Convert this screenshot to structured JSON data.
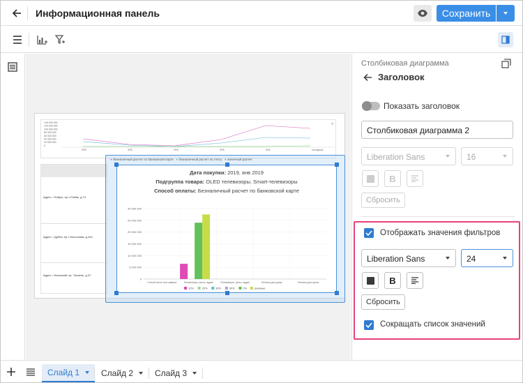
{
  "header": {
    "title": "Информационная панель",
    "save_label": "Сохранить"
  },
  "right_panel": {
    "type_label": "Столбиковая диаграмма",
    "heading": "Заголовок",
    "show_title_label": "Показать заголовок",
    "show_title_on": false,
    "title_value": "Столбиковая диаграмма 2",
    "title_font": "Liberation Sans",
    "title_size": "16",
    "reset_label": "Сбросить",
    "filters_checkbox_label": "Отображать значения фильтров",
    "filters_checked": true,
    "filters_font": "Liberation Sans",
    "filters_size": "24",
    "filters_reset_label": "Сбросить",
    "shorten_label": "Сокращать список значений",
    "shorten_checked": true
  },
  "tabs": [
    {
      "label": "Слайд 1",
      "active": true
    },
    {
      "label": "Слайд 2",
      "active": false
    },
    {
      "label": "Слайд 3",
      "active": false
    }
  ],
  "canvas": {
    "mini_legend": [
      "безналичный расчет по банковской карте",
      "безналичный расчет по счету",
      "наличный расчет"
    ],
    "mini_line": {
      "y_ticks": [
        "140 000 000",
        "120 000 000",
        "100 000 000",
        "80 000 000",
        "60 000 000",
        "40 000 000",
        "20 000 000",
        "0"
      ],
      "categories": [
        "ХРА",
        "ХРА",
        "ХРА",
        "ХРА",
        "ХРА",
        "Холодные"
      ]
    },
    "mini_table_rows": [
      "Адрес > Бобры, пр-т Рыбак, д.74",
      "Адрес > Дубна, пр-т Бессонова, д.244",
      "Адрес > Волжский, пр. Тагмень, д.37"
    ],
    "chart_filters": [
      {
        "label": "Дата покупки:",
        "value": "2019, янв 2019"
      },
      {
        "label": "Подгруппа товара:",
        "value": "OLED телевизоры, Smart-телевизоры"
      },
      {
        "label": "Способ оплаты:",
        "value": "Безналичный расчет по банковской карте"
      }
    ]
  },
  "chart_data": {
    "type": "bar",
    "y_ticks": [
      "30 000 000",
      "25 000 000",
      "20 000 000",
      "15 000 000",
      "10 000 000",
      "5 000 000",
      "0"
    ],
    "ylim": [
      0,
      30000000
    ],
    "categories": [
      "Способ фото или камера",
      "Телевизоры, фото, аудио",
      "Телевизоры, фото, аудио",
      "Техника для дома",
      "Техника для кухни"
    ],
    "series": [
      {
        "name": "10%",
        "color": "#e04bb5",
        "values": [
          0,
          6500000,
          0,
          0,
          0
        ]
      },
      {
        "name": "20%",
        "color": "#9fd6a0",
        "values": [
          0,
          0,
          0,
          0,
          0
        ]
      },
      {
        "name": "30%",
        "color": "#64b8d8",
        "values": [
          0,
          0,
          0,
          0,
          0
        ]
      },
      {
        "name": "30%",
        "color": "#b59fd6",
        "values": [
          0,
          0,
          0,
          0,
          0
        ]
      },
      {
        "name": "0%",
        "color": "#63c05a",
        "values": [
          0,
          24000000,
          0,
          0,
          0
        ]
      },
      {
        "name": "разовые",
        "color": "#c8dc4a",
        "values": [
          0,
          27500000,
          0,
          0,
          0
        ]
      }
    ]
  }
}
